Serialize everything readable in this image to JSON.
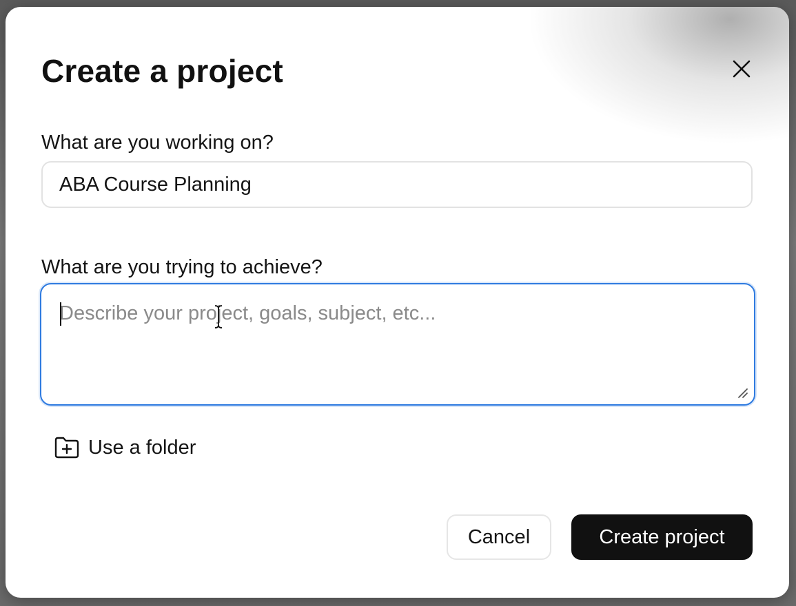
{
  "dialog": {
    "title": "Create a project",
    "close_icon": "close-icon"
  },
  "fields": {
    "name": {
      "label": "What are you working on?",
      "value": "ABA Course Planning"
    },
    "goal": {
      "label": "What are you trying to achieve?",
      "placeholder": "Describe your project, goals, subject, etc...",
      "value": ""
    }
  },
  "folder": {
    "icon": "folder-plus-icon",
    "label": "Use a folder"
  },
  "actions": {
    "cancel_label": "Cancel",
    "create_label": "Create project"
  },
  "colors": {
    "focus_border": "#2f7be0",
    "primary_button": "#111111"
  }
}
